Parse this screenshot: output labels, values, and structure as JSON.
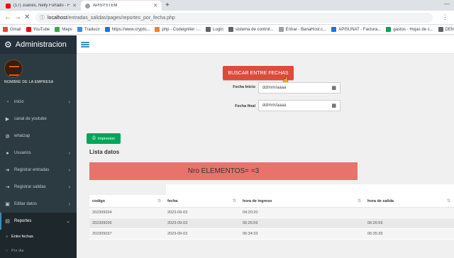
{
  "browser": {
    "tabs": [
      {
        "label": "(17) Juanes, Nelly Furtado - Fot...",
        "favicon_color": "#ff0000",
        "active": false
      },
      {
        "label": "APISYSTEM",
        "favicon_color": "#5f6368",
        "active": true
      }
    ],
    "new_tab_glyph": "+",
    "url_host": "localhost",
    "url_path": "/entradas_salidas/pages/reportes_por_fecha.php",
    "bookmarks": [
      {
        "label": "Gmail",
        "color": "#ea4335"
      },
      {
        "label": "YouTube",
        "color": "#ff0000"
      },
      {
        "label": "Maps",
        "color": "#34a853"
      },
      {
        "label": "Traducir",
        "color": "#4285f4"
      },
      {
        "label": "https://www.crypto...",
        "color": "#1a73e8"
      },
      {
        "label": "php - Codeigniter -...",
        "color": "#f48024"
      },
      {
        "label": "Login",
        "color": "#5f6368"
      },
      {
        "label": "sistema de control...",
        "color": "#5f6368"
      },
      {
        "label": "Entrar - BanaHost.c...",
        "color": "#9aa0a6"
      },
      {
        "label": "APISUNAT - Factura...",
        "color": "#1a73e8"
      },
      {
        "label": "gastos - Hojas de c...",
        "color": "#0f9d58"
      },
      {
        "label": "DEMO S",
        "color": "#5f6368"
      }
    ]
  },
  "sidebar": {
    "title": "Administracion",
    "company": "NOMBRE DE LA EMPRESA",
    "items": [
      {
        "label": "inicio",
        "icon": "dashboard-icon",
        "glyph": "◔",
        "has_arrow": true
      },
      {
        "label": "canal de youtube",
        "icon": "youtube-icon",
        "glyph": "▶",
        "has_arrow": false
      },
      {
        "label": "whatzap",
        "icon": "chat-icon",
        "glyph": "◍",
        "has_arrow": false
      },
      {
        "label": "Usuarios",
        "icon": "users-icon",
        "glyph": "●",
        "has_arrow": true
      },
      {
        "label": "Registrar entradas",
        "icon": "login-icon",
        "glyph": "➜",
        "has_arrow": true
      },
      {
        "label": "Registrar salidas",
        "icon": "logout-icon",
        "glyph": "⇥",
        "has_arrow": true
      },
      {
        "label": "Editar datos",
        "icon": "edit-icon",
        "glyph": "▣",
        "has_arrow": true
      },
      {
        "label": "Reportes",
        "icon": "reports-icon",
        "glyph": "▤",
        "has_arrow": true
      }
    ],
    "subitems": [
      {
        "label": "Entre fechas"
      },
      {
        "label": "Por dia"
      }
    ]
  },
  "main": {
    "search_button": "BUSCAR ENTRE FECHAS",
    "fecha_inicio_label": "Fecha Inicio",
    "fecha_final_label": "Fecha final",
    "date_placeholder": "dd/mm/aaaa",
    "print_button": "Impresion",
    "list_title": "Lista datos",
    "count_text": "Nro ELEMENTOS= =3",
    "colors": {
      "danger": "#dd4b39",
      "success": "#00a65a",
      "banner": "#e8736c",
      "sidebar": "#2c3b41"
    }
  },
  "table": {
    "headers": [
      "codigo",
      "fecha",
      "hora de ingreso",
      "hora de salida"
    ],
    "rows": [
      [
        "202309034",
        "2023-09-03",
        "04:20:20",
        ""
      ],
      [
        "202309036",
        "2023-09-03",
        "06:26:59",
        "06:26:59"
      ],
      [
        "202309037",
        "2023-09-03",
        "06:34:33",
        "06:35:39"
      ]
    ]
  }
}
